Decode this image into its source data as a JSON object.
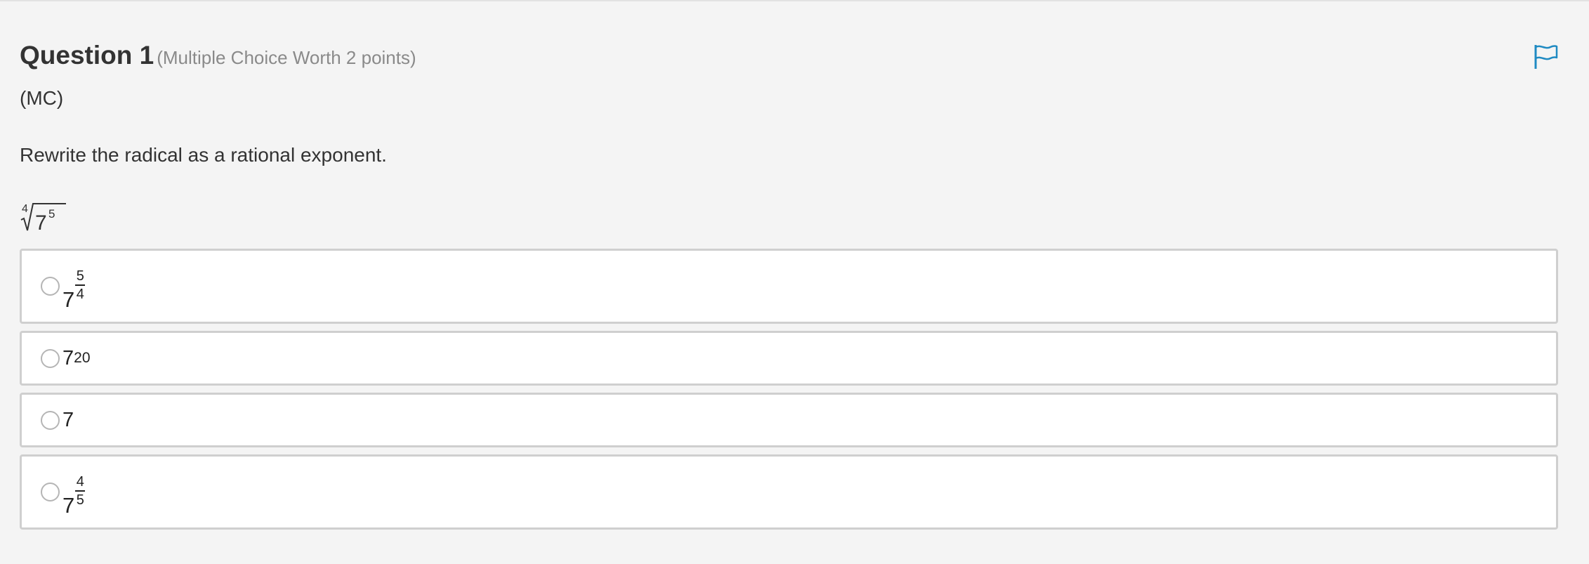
{
  "question": {
    "title": "Question 1",
    "meta": "(Multiple Choice Worth 2 points)",
    "tag": "(MC)",
    "prompt": "Rewrite the radical as a rational exponent.",
    "expression": {
      "index": "4",
      "base": "7",
      "exponent": "5"
    },
    "flag_icon": "flag-icon",
    "accent_color": "#1f8ac2"
  },
  "choices": [
    {
      "base": "7",
      "numerator": "5",
      "denominator": "4",
      "selected": false
    },
    {
      "base": "7",
      "exponent": "20",
      "selected": false
    },
    {
      "base": "7",
      "selected": false
    },
    {
      "base": "7",
      "numerator": "4",
      "denominator": "5",
      "selected": false
    }
  ]
}
